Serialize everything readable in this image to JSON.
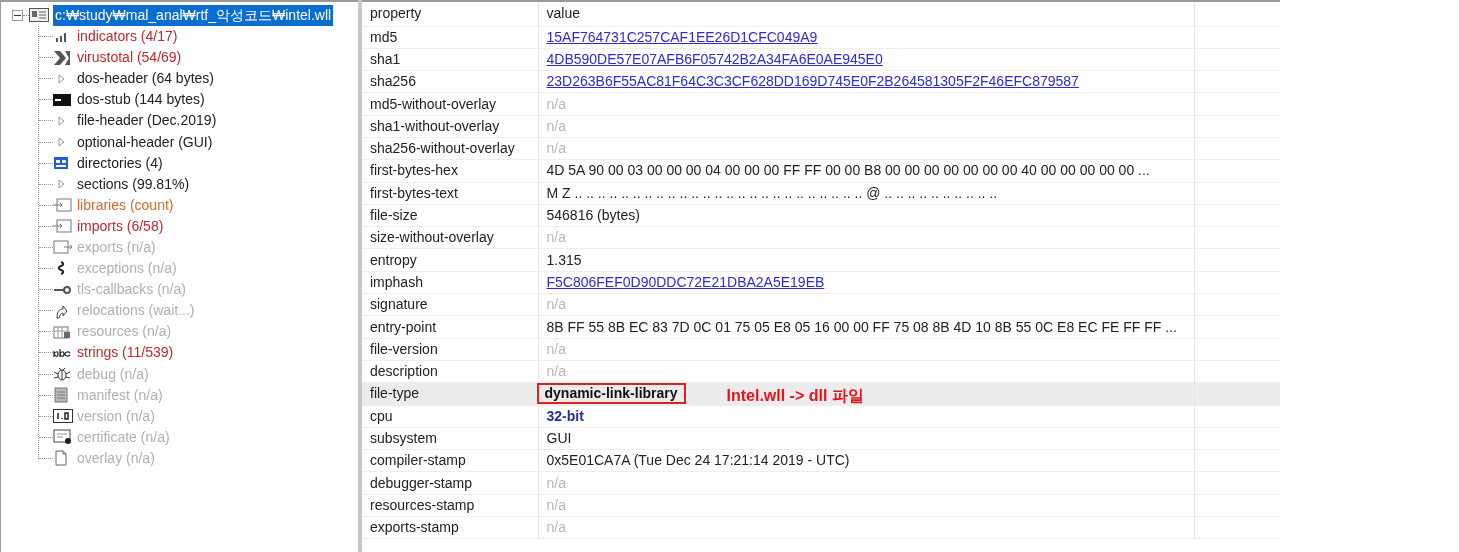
{
  "tree": {
    "label": "c:₩study₩mal_anal₩rtf_악성코드₩intel.wll",
    "selected": true,
    "expanded": true,
    "children": [
      {
        "label": "indicators (4/17)",
        "color": "#c0282c"
      },
      {
        "label": "virustotal (54/69)",
        "color": "#c0282c"
      },
      {
        "label": "dos-header (64 bytes)",
        "color": "#222222"
      },
      {
        "label": "dos-stub (144 bytes)",
        "color": "#222222"
      },
      {
        "label": "file-header (Dec.2019)",
        "color": "#222222"
      },
      {
        "label": "optional-header (GUI)",
        "color": "#222222"
      },
      {
        "label": "directories (4)",
        "color": "#222222"
      },
      {
        "label": "sections (99.81%)",
        "color": "#222222"
      },
      {
        "label": "libraries (count)",
        "color": "#d2692a"
      },
      {
        "label": "imports (6/58)",
        "color": "#c0282c"
      },
      {
        "label": "exports (n/a)",
        "color": "#b0b0b0"
      },
      {
        "label": "exceptions (n/a)",
        "color": "#b0b0b0"
      },
      {
        "label": "tls-callbacks (n/a)",
        "color": "#b0b0b0"
      },
      {
        "label": "relocations (wait...)",
        "color": "#b0b0b0"
      },
      {
        "label": "resources (n/a)",
        "color": "#b0b0b0"
      },
      {
        "label": "strings (11/539)",
        "color": "#c0282c"
      },
      {
        "label": "debug (n/a)",
        "color": "#b0b0b0"
      },
      {
        "label": "manifest (n/a)",
        "color": "#b0b0b0"
      },
      {
        "label": "version (n/a)",
        "color": "#b0b0b0"
      },
      {
        "label": "certificate (n/a)",
        "color": "#b0b0b0"
      },
      {
        "label": "overlay (n/a)",
        "color": "#b0b0b0"
      }
    ]
  },
  "table": {
    "columns": [
      "property",
      "value"
    ],
    "rows": [
      {
        "property": "md5",
        "value": "15AF764731C257CAF1EE26D1CFC049A9",
        "kind": "link",
        "selected": false
      },
      {
        "property": "sha1",
        "value": "4DB590DE57E07AFB6F05742B2A34FA6E0AE945E0",
        "kind": "link",
        "selected": false
      },
      {
        "property": "sha256",
        "value": "23D263B6F55AC81F64C3C3CF628DD169D745E0F2B264581305F2F46EFC879587",
        "kind": "link",
        "selected": false
      },
      {
        "property": "md5-without-overlay",
        "value": "n/a",
        "kind": "missing",
        "selected": false
      },
      {
        "property": "sha1-without-overlay",
        "value": "n/a",
        "kind": "missing",
        "selected": false
      },
      {
        "property": "sha256-without-overlay",
        "value": "n/a",
        "kind": "missing",
        "selected": false
      },
      {
        "property": "first-bytes-hex",
        "value": "4D 5A 90 00 03 00 00 00 04 00 00 00 FF FF 00 00 B8 00 00 00 00 00 00 00 40 00 00 00 00 00 ...",
        "kind": "text",
        "selected": false
      },
      {
        "property": "first-bytes-text",
        "value": "M Z .. .. .. .. .. .. .. .. .. .. .. .. .. .. .. .. .. .. .. .. .. .. .. .. .. @ .. .. .. .. .. .. .. .. .. ..",
        "kind": "text",
        "selected": false
      },
      {
        "property": "file-size",
        "value": "546816 (bytes)",
        "kind": "text",
        "selected": false
      },
      {
        "property": "size-without-overlay",
        "value": "n/a",
        "kind": "missing",
        "selected": false
      },
      {
        "property": "entropy",
        "value": "1.315",
        "kind": "text",
        "selected": false
      },
      {
        "property": "imphash",
        "value": "F5C806FEF0D90DDC72E21DBA2A5E19EB",
        "kind": "link",
        "selected": false
      },
      {
        "property": "signature",
        "value": "n/a",
        "kind": "missing",
        "selected": false
      },
      {
        "property": "entry-point",
        "value": "8B FF 55 8B EC 83 7D 0C 01 75 05 E8 05 16 00 00 FF 75 08 8B 4D 10 8B 55 0C E8 EC FE FF FF ...",
        "kind": "text",
        "selected": false
      },
      {
        "property": "file-version",
        "value": "n/a",
        "kind": "missing",
        "selected": false
      },
      {
        "property": "description",
        "value": "n/a",
        "kind": "missing",
        "selected": false
      },
      {
        "property": "file-type",
        "value": "dynamic-link-library",
        "kind": "bold",
        "selected": true,
        "annotation": "Intel.wll -> dll 파일"
      },
      {
        "property": "cpu",
        "value": "32-bit",
        "kind": "emphasis",
        "selected": false
      },
      {
        "property": "subsystem",
        "value": "GUI",
        "kind": "text",
        "selected": false
      },
      {
        "property": "compiler-stamp",
        "value": "0x5E01CA7A (Tue Dec 24 17:21:14 2019 - UTC)",
        "kind": "text",
        "selected": false
      },
      {
        "property": "debugger-stamp",
        "value": "n/a",
        "kind": "missing",
        "selected": false
      },
      {
        "property": "resources-stamp",
        "value": "n/a",
        "kind": "missing",
        "selected": false
      },
      {
        "property": "exports-stamp",
        "value": "n/a",
        "kind": "missing",
        "selected": false
      }
    ]
  }
}
